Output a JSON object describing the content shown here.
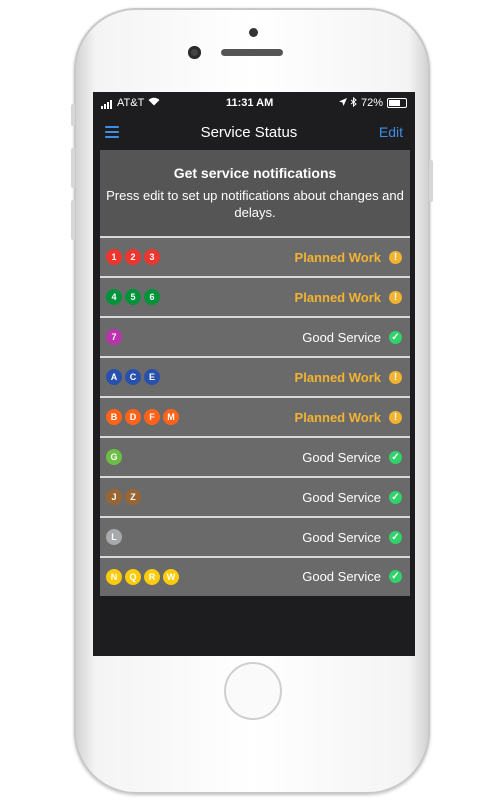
{
  "status_bar": {
    "carrier": "AT&T",
    "time": "11:31 AM",
    "battery": "72%"
  },
  "nav": {
    "title": "Service Status",
    "edit_label": "Edit"
  },
  "notice": {
    "title": "Get service notifications",
    "body": "Press edit to set up notifications about changes and delays."
  },
  "lines": [
    {
      "bullets": [
        {
          "label": "1",
          "color": "#ee352e"
        },
        {
          "label": "2",
          "color": "#ee352e"
        },
        {
          "label": "3",
          "color": "#ee352e"
        }
      ],
      "status": "Planned Work",
      "kind": "planned"
    },
    {
      "bullets": [
        {
          "label": "4",
          "color": "#00933c"
        },
        {
          "label": "5",
          "color": "#00933c"
        },
        {
          "label": "6",
          "color": "#00933c"
        }
      ],
      "status": "Planned Work",
      "kind": "planned"
    },
    {
      "bullets": [
        {
          "label": "7",
          "color": "#b933ad"
        }
      ],
      "status": "Good Service",
      "kind": "good"
    },
    {
      "bullets": [
        {
          "label": "A",
          "color": "#2850ad"
        },
        {
          "label": "C",
          "color": "#2850ad"
        },
        {
          "label": "E",
          "color": "#2850ad"
        }
      ],
      "status": "Planned Work",
      "kind": "planned"
    },
    {
      "bullets": [
        {
          "label": "B",
          "color": "#ff6319"
        },
        {
          "label": "D",
          "color": "#ff6319"
        },
        {
          "label": "F",
          "color": "#ff6319"
        },
        {
          "label": "M",
          "color": "#ff6319"
        }
      ],
      "status": "Planned Work",
      "kind": "planned"
    },
    {
      "bullets": [
        {
          "label": "G",
          "color": "#6cbe45"
        }
      ],
      "status": "Good Service",
      "kind": "good"
    },
    {
      "bullets": [
        {
          "label": "J",
          "color": "#996633"
        },
        {
          "label": "Z",
          "color": "#996633"
        }
      ],
      "status": "Good Service",
      "kind": "good"
    },
    {
      "bullets": [
        {
          "label": "L",
          "color": "#a7a9ac"
        }
      ],
      "status": "Good Service",
      "kind": "good"
    },
    {
      "bullets": [
        {
          "label": "N",
          "color": "#fccc0a"
        },
        {
          "label": "Q",
          "color": "#fccc0a"
        },
        {
          "label": "R",
          "color": "#fccc0a"
        },
        {
          "label": "W",
          "color": "#fccc0a"
        }
      ],
      "status": "Good Service",
      "kind": "good"
    }
  ]
}
